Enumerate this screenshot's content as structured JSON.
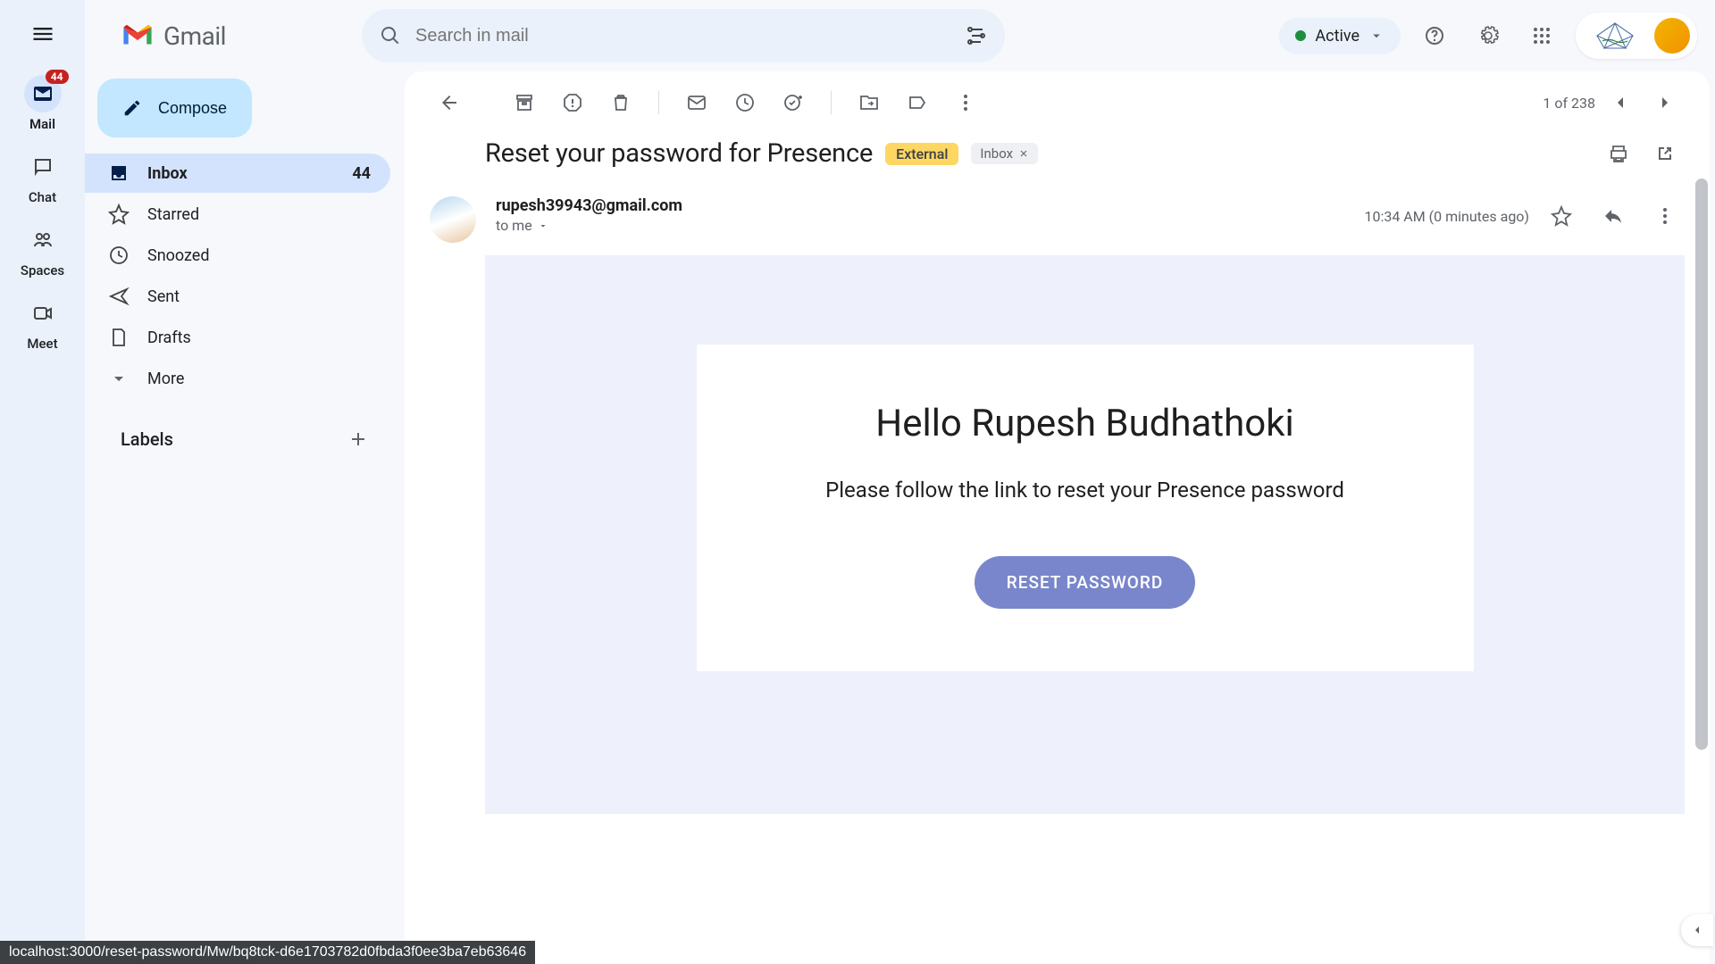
{
  "app_name": "Gmail",
  "rail": {
    "badge_count": "44",
    "items": [
      {
        "label": "Mail",
        "active": true
      },
      {
        "label": "Chat",
        "active": false
      },
      {
        "label": "Spaces",
        "active": false
      },
      {
        "label": "Meet",
        "active": false
      }
    ]
  },
  "search": {
    "placeholder": "Search in mail"
  },
  "status": {
    "label": "Active"
  },
  "compose_label": "Compose",
  "folders": [
    {
      "label": "Inbox",
      "count": "44",
      "active": true
    },
    {
      "label": "Starred"
    },
    {
      "label": "Snoozed"
    },
    {
      "label": "Sent"
    },
    {
      "label": "Drafts"
    },
    {
      "label": "More"
    }
  ],
  "labels_header": "Labels",
  "message": {
    "subject": "Reset your password for Presence",
    "external_badge": "External",
    "category_badge": "Inbox",
    "pager": "1 of 238",
    "sender_email": "rupesh39943@gmail.com",
    "to_line": "to me",
    "timestamp": "10:34 AM (0 minutes ago)",
    "body": {
      "greeting": "Hello Rupesh Budhathoki",
      "instruction": "Please follow the link to reset your Presence password",
      "button_label": "RESET PASSWORD"
    }
  },
  "status_bar": "localhost:3000/reset-password/Mw/bq8tck-d6e1703782d0fbda3f0ee3ba7eb63646"
}
